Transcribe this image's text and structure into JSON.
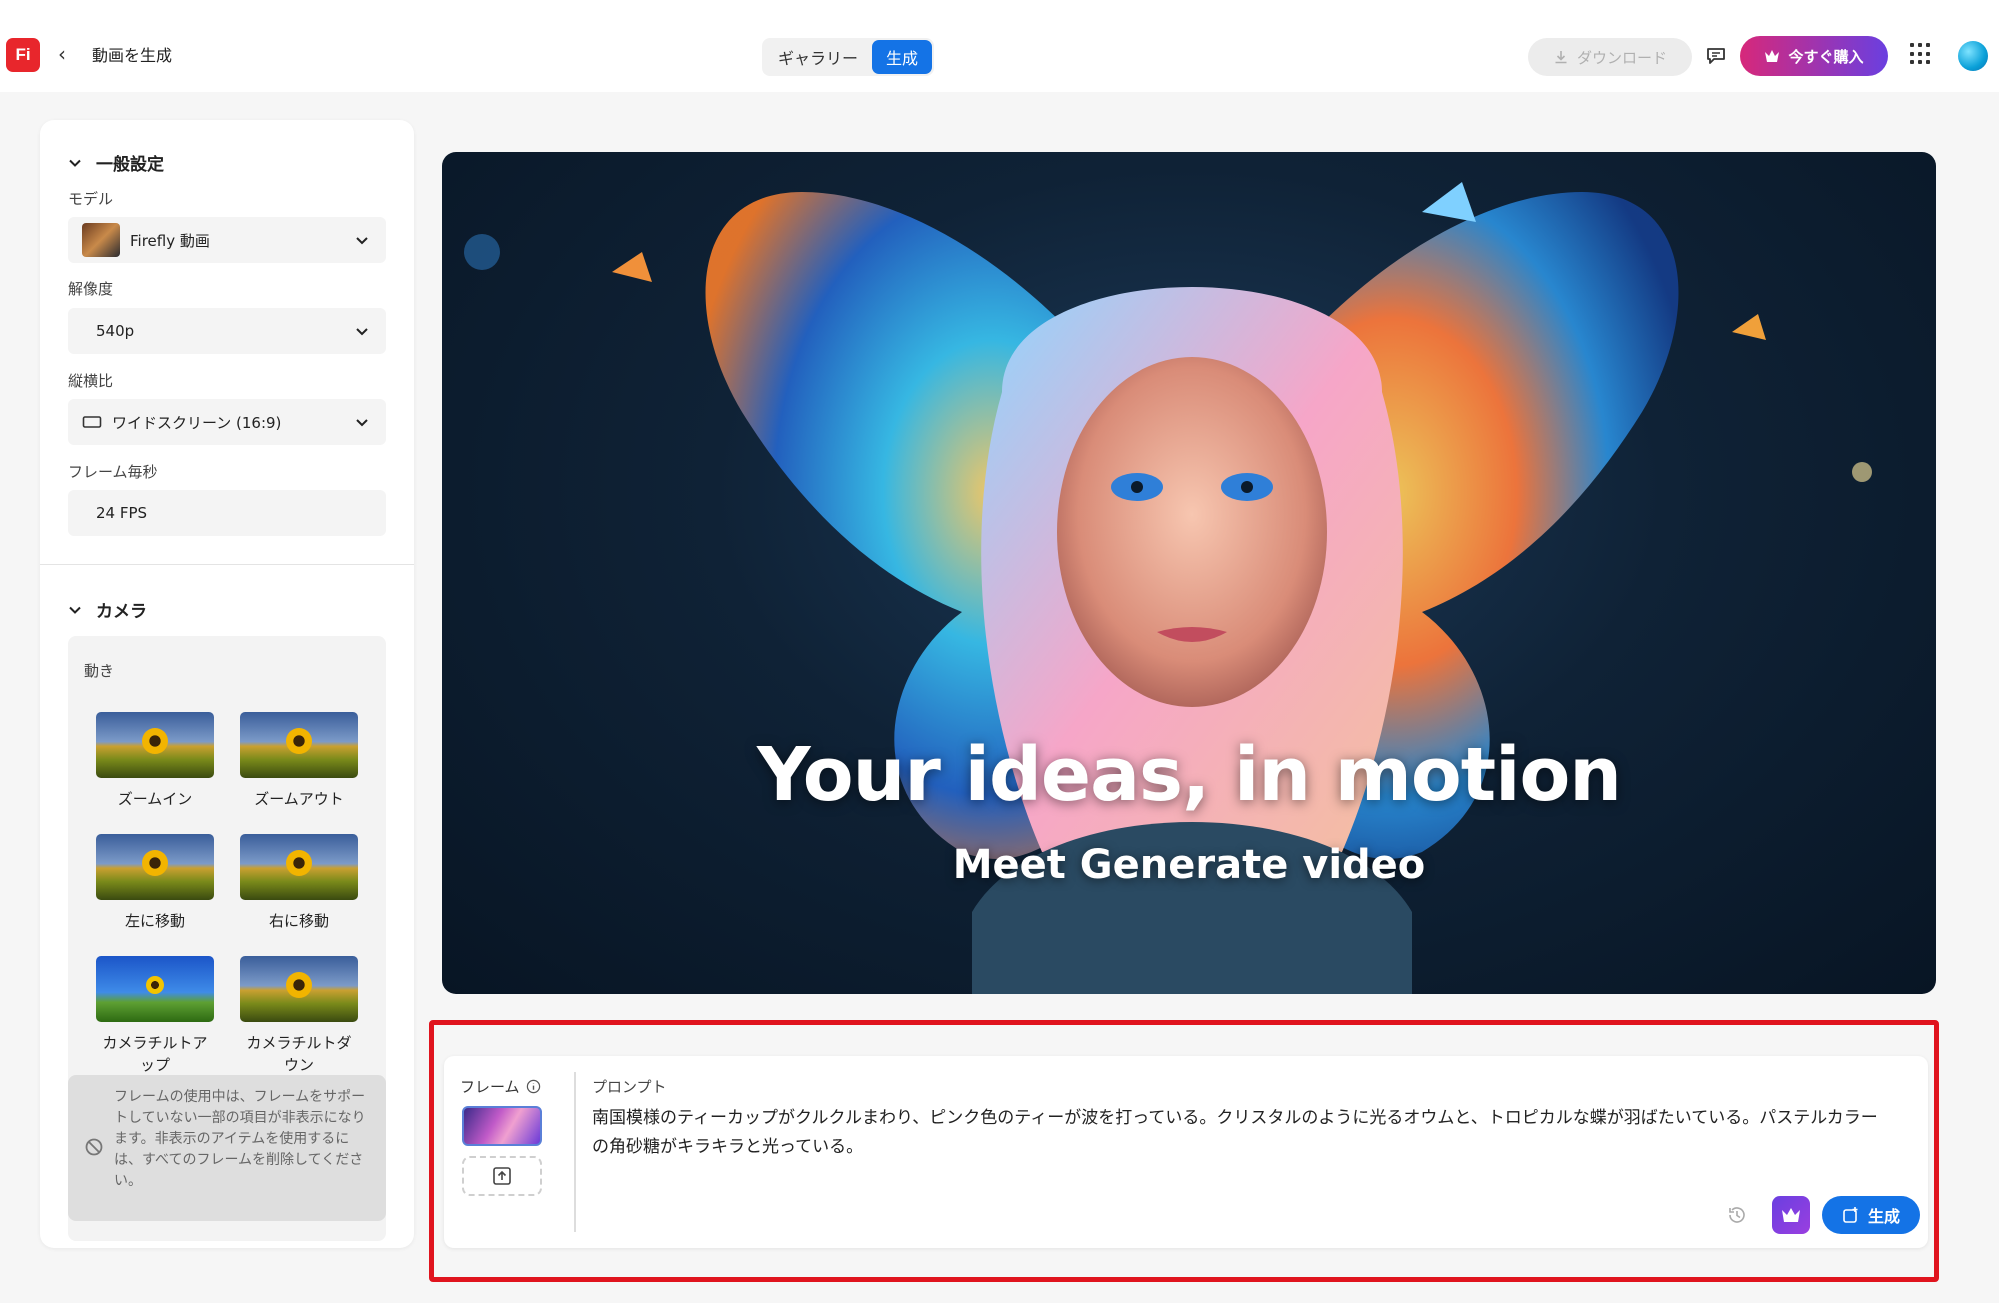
{
  "app": {
    "logo_text": "Fi",
    "page_title": "動画を生成"
  },
  "header": {
    "tabs": [
      {
        "label": "ギャラリー",
        "active": false
      },
      {
        "label": "生成",
        "active": true
      }
    ],
    "download_label": "ダウンロード",
    "buy_label": "今すぐ購入",
    "accent_color": "#1473e6"
  },
  "sidebar": {
    "general": {
      "title": "一般設定",
      "model_label": "モデル",
      "model_value": "Firefly 動画",
      "resolution_label": "解像度",
      "resolution_value": "540p",
      "aspect_label": "縦横比",
      "aspect_value": "ワイドスクリーン (16:9)",
      "fps_label": "フレーム毎秒",
      "fps_value": "24 FPS"
    },
    "camera": {
      "title": "カメラ",
      "motion_label": "動き",
      "motions": [
        {
          "label": "ズームイン"
        },
        {
          "label": "ズームアウト"
        },
        {
          "label": "左に移動"
        },
        {
          "label": "右に移動"
        },
        {
          "label": "カメラチルトアップ"
        },
        {
          "label": "カメラチルトダウン"
        }
      ],
      "notice": "フレームの使用中は、フレームをサポートしていない一部の項目が非表示になります。非表示のアイテムを使用するには、すべてのフレームを削除してください。"
    }
  },
  "hero": {
    "title": "Your ideas, in motion",
    "subtitle": "Meet Generate video"
  },
  "prompt": {
    "frame_label": "フレーム",
    "prompt_label": "プロンプト",
    "prompt_text": "南国模様のティーカップがクルクルまわり、ピンク色のティーが波を打っている。クリスタルのように光るオウムと、トロピカルな蝶が羽ばたいている。パステルカラーの角砂糖がキラキラと光っている。",
    "generate_label": "生成",
    "highlight_color": "#e0141e"
  }
}
